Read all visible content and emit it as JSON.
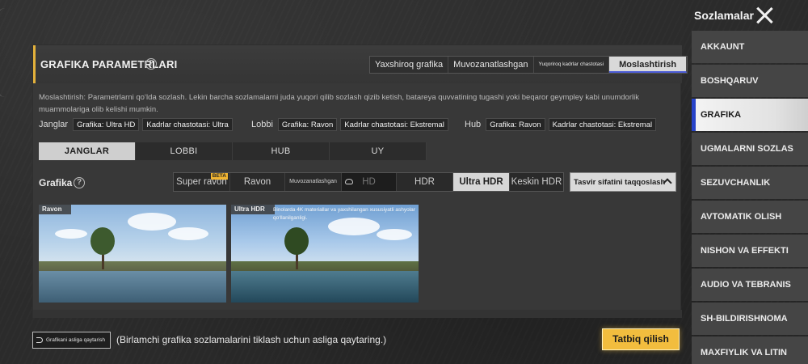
{
  "sidebar": {
    "title": "Sozlamalar",
    "items": [
      {
        "label": "AKKAUNT"
      },
      {
        "label": "BOSHQARUV"
      },
      {
        "label": "GRAFIKA"
      },
      {
        "label": "UGMALARNI SOZLAS"
      },
      {
        "label": "SEZUVCHANLIK"
      },
      {
        "label": "AVTOMATIK OLISH"
      },
      {
        "label": "NISHON VA EFFEKTI"
      },
      {
        "label": "AUDIO VA TEBRANIS"
      },
      {
        "label": "SH-BILDIRISHNOMA"
      },
      {
        "label": "MAXFIYLIK VA LITIN"
      }
    ],
    "active_index": 2
  },
  "panel": {
    "title": "GRAFIKA PARAMETRLARI",
    "presets": [
      {
        "label": "Yaxshiroq grafika"
      },
      {
        "label": "Muvozanatlashgan"
      },
      {
        "label": "Yuqoriroq kadrlar chastotasi"
      },
      {
        "label": "Moslashtirish"
      }
    ],
    "active_preset": 3,
    "description": "Moslashtirish: Parametrlarni qo‘lda sozlash. Lekin barcha sozlamalarni juda yuqori qilib sozlash qizib ketish, batareya quvvatining tugashi yoki beqaror geympley kabi unumdorlik muammolariga olib kelishi mumkin.",
    "summary": [
      {
        "label": "Janglar",
        "grafika": "Grafika: Ultra HD",
        "fps": "Kadrlar chastotasi: Ultra"
      },
      {
        "label": "Lobbi",
        "grafika": "Grafika: Ravon",
        "fps": "Kadrlar chastotasi: Ekstremal"
      },
      {
        "label": "Hub",
        "grafika": "Grafika: Ravon",
        "fps": "Kadrlar chastotasi: Ekstremal"
      }
    ],
    "mode_tabs": [
      {
        "label": "JANGLAR"
      },
      {
        "label": "LOBBI"
      },
      {
        "label": "HUB"
      },
      {
        "label": "UY"
      }
    ],
    "active_mode": 0,
    "grafika_label": "Grafika",
    "quality_options": [
      {
        "label": "Super ravon",
        "badge": "BETA"
      },
      {
        "label": "Ravon"
      },
      {
        "label": "Muvozanatlashgan"
      },
      {
        "label": "HD"
      },
      {
        "label": "HDR"
      },
      {
        "label": "Ultra HDR"
      },
      {
        "label": "Keskin HDR"
      }
    ],
    "active_quality": 5,
    "compare_button": "Tasvir sifatini taqqoslash",
    "previews": [
      {
        "tag": "Ravon",
        "caption": ""
      },
      {
        "tag": "Ultra HDR",
        "caption": "Binolarda 4K materiallar va yaxshilangan xususiyatli ashyolar qo‘llanilganligi."
      }
    ]
  },
  "footer": {
    "reset_button": "Grafikani asliga qaytarish",
    "reset_note": "(Birlamchi grafika sozlamalarini tiklash uchun asliga qaytaring.)",
    "apply_button": "Tatbiq qilish"
  },
  "colors": {
    "accent": "#f2bd3e",
    "active_indicator": "#2743c9",
    "panel_bg": "#383838"
  }
}
